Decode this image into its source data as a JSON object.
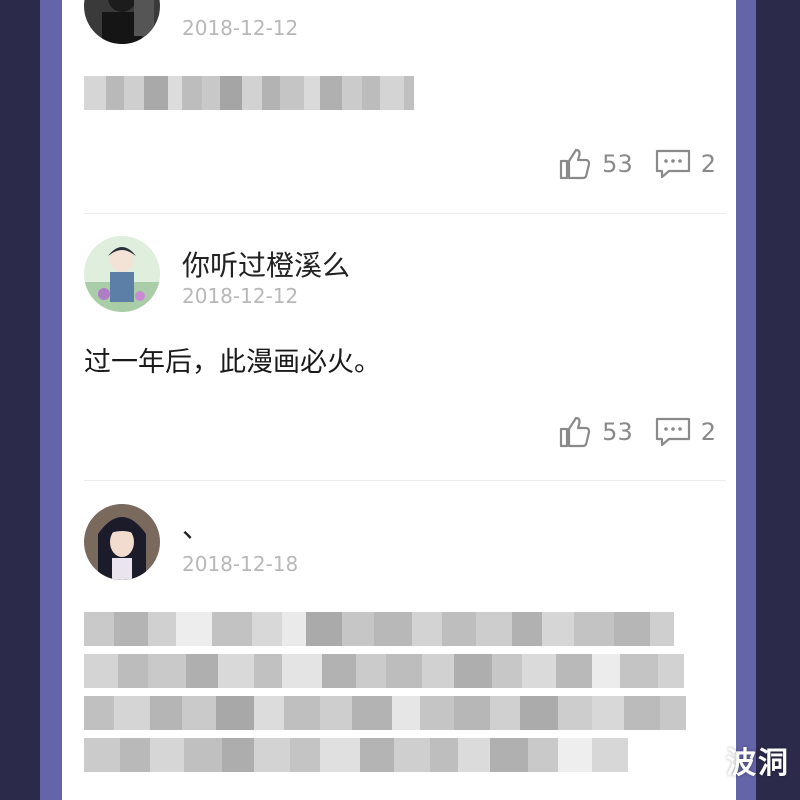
{
  "comments": [
    {
      "username": "",
      "date": "2018-12-12",
      "likes": "53",
      "replies": "2"
    },
    {
      "username": "你听过橙溪么",
      "date": "2018-12-12",
      "text": "过一年后，此漫画必火。",
      "likes": "53",
      "replies": "2"
    },
    {
      "username": "、",
      "date": "2018-12-18"
    }
  ],
  "icons": {
    "like": "thumbs-up-icon",
    "reply": "comment-bubble-icon"
  },
  "watermark": {
    "text": "波洞"
  },
  "colors": {
    "background": "#2b2a4a",
    "frame": "#6464a8",
    "card": "#ffffff",
    "date": "#b8b8b8",
    "action": "#8a8a8a"
  }
}
